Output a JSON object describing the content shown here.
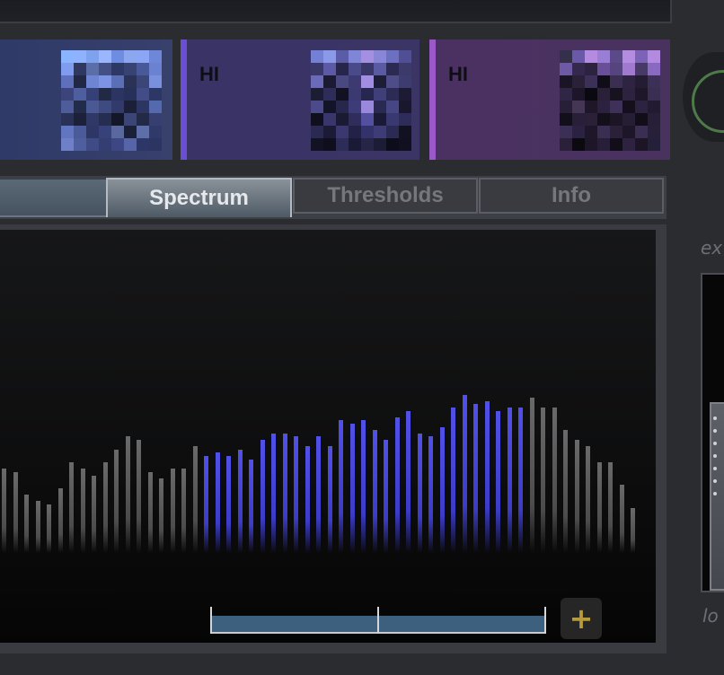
{
  "bands": [
    {
      "label": "",
      "accent": "#2f3a68",
      "grid": [
        "#8ab4ff",
        "#8fb2ff",
        "#7fa2ef",
        "#9bb6ff",
        "#6f8de0",
        "#8ca7f0",
        "#8aa6f4",
        "#6f87d8",
        "#7f9cf0",
        "#2f3860",
        "#5b6ea8",
        "#444f86",
        "#2e3866",
        "#394373",
        "#485898",
        "#6a82cf",
        "#5e70bb",
        "#202846",
        "#6e85d3",
        "#7d94e4",
        "#5b6fb6",
        "#2b3258",
        "#3b4577",
        "#7890de",
        "#3c457b",
        "#4e5e9f",
        "#354079",
        "#212945",
        "#2c3562",
        "#273058",
        "#424d87",
        "#2d3765",
        "#4f5c9b",
        "#232b4b",
        "#4a5894",
        "#3e4a80",
        "#313a6a",
        "#1b2038",
        "#2d3663",
        "#556aae",
        "#2a3158",
        "#1c2139",
        "#2f3866",
        "#252d50",
        "#131727",
        "#3b4677",
        "#222a48",
        "#363f70",
        "#6275c0",
        "#4b5a98",
        "#2d3664",
        "#38427a",
        "#59689f",
        "#1b2039",
        "#5d6ea9",
        "#303a6a",
        "#6e80c7",
        "#4e5e9f",
        "#3f4b85",
        "#343e73",
        "#3c4784",
        "#5765a8",
        "#2d3767",
        "#2c3561"
      ]
    },
    {
      "label": "HI",
      "accent": "#6b4fd2",
      "grid": [
        "#7480d4",
        "#8a9ae8",
        "#5a5ca8",
        "#7f86d8",
        "#a48fe0",
        "#8a86d6",
        "#6d6fc0",
        "#504f96",
        "#3a3868",
        "#5c5aa6",
        "#27254a",
        "#4a4a8a",
        "#383768",
        "#5a5aa2",
        "#2b2a52",
        "#3b3a6b",
        "#6a6ab8",
        "#1b1a33",
        "#4a4880",
        "#3c3a70",
        "#a18ee2",
        "#1e1d38",
        "#4e4d88",
        "#3d3c70",
        "#1d1c35",
        "#2e2c58",
        "#111122",
        "#3a3970",
        "#272650",
        "#413f7a",
        "#2c2b55",
        "#1c1b33",
        "#4c4a8a",
        "#141428",
        "#27264c",
        "#3e3c78",
        "#9a88dc",
        "#2a2952",
        "#464684",
        "#18172e",
        "#0f0f1e",
        "#38366a",
        "#1a1a33",
        "#2f2e5a",
        "#5350a0",
        "#1a1936",
        "#3a3870",
        "#2e2c5a",
        "#2a2952",
        "#1c1b37",
        "#3a386e",
        "#232246",
        "#34326a",
        "#3e3c76",
        "#2b2a55",
        "#111122",
        "#121225",
        "#0e0e1d",
        "#2d2c58",
        "#1b1a36",
        "#262548",
        "#1d1c37",
        "#0c0c1a",
        "#101020"
      ]
    },
    {
      "label": "HI",
      "accent": "#9a58c8",
      "grid": [
        "#34304c",
        "#6a58a8",
        "#b48be0",
        "#9a7ed6",
        "#5a4a8a",
        "#b48ce0",
        "#7d63b8",
        "#b28adf",
        "#6e5aa4",
        "#34284c",
        "#2c2340",
        "#694e98",
        "#56447e",
        "#a17ad0",
        "#473a66",
        "#8a6ac0",
        "#1a1524",
        "#2a2138",
        "#3c2f58",
        "#110d18",
        "#3a2e52",
        "#2e2442",
        "#241c33",
        "#3d3056",
        "#2f2544",
        "#1c1628",
        "#0b0910",
        "#2a2138",
        "#17121f",
        "#2d2340",
        "#1d1729",
        "#3a2e52",
        "#271f37",
        "#453656",
        "#1e1729",
        "#2c2240",
        "#3e3058",
        "#140f1b",
        "#2c2340",
        "#221a30",
        "#130f1a",
        "#281f38",
        "#2a2138",
        "#130f1b",
        "#1b1526",
        "#261e35",
        "#120e19",
        "#271f37",
        "#3c2f56",
        "#2b2241",
        "#1d1729",
        "#3a2e52",
        "#2a2138",
        "#1c1628",
        "#3a2e52",
        "#281f38",
        "#2a2138",
        "#0c0a11",
        "#1c1628",
        "#271f37",
        "#120e19",
        "#2d2340",
        "#1b1526",
        "#24203a"
      ]
    }
  ],
  "tabs": [
    {
      "label": "Spectrum",
      "active": true
    },
    {
      "label": "Thresholds",
      "active": false
    },
    {
      "label": "Info",
      "active": false
    }
  ],
  "spectrum": {
    "colors": {
      "inactive": "#555555",
      "active": "#4444dd"
    },
    "bars": [
      {
        "level": 0.26,
        "active": false
      },
      {
        "level": 0.25,
        "active": false
      },
      {
        "level": 0.18,
        "active": false
      },
      {
        "level": 0.16,
        "active": false
      },
      {
        "level": 0.15,
        "active": false
      },
      {
        "level": 0.2,
        "active": false
      },
      {
        "level": 0.28,
        "active": false
      },
      {
        "level": 0.26,
        "active": false
      },
      {
        "level": 0.24,
        "active": false
      },
      {
        "level": 0.28,
        "active": false
      },
      {
        "level": 0.32,
        "active": false
      },
      {
        "level": 0.36,
        "active": false
      },
      {
        "level": 0.35,
        "active": false
      },
      {
        "level": 0.25,
        "active": false
      },
      {
        "level": 0.23,
        "active": false
      },
      {
        "level": 0.26,
        "active": false
      },
      {
        "level": 0.26,
        "active": false
      },
      {
        "level": 0.33,
        "active": false
      },
      {
        "level": 0.3,
        "active": true
      },
      {
        "level": 0.31,
        "active": true
      },
      {
        "level": 0.3,
        "active": true
      },
      {
        "level": 0.32,
        "active": true
      },
      {
        "level": 0.29,
        "active": true
      },
      {
        "level": 0.35,
        "active": true
      },
      {
        "level": 0.37,
        "active": true
      },
      {
        "level": 0.37,
        "active": true
      },
      {
        "level": 0.36,
        "active": true
      },
      {
        "level": 0.33,
        "active": true
      },
      {
        "level": 0.36,
        "active": true
      },
      {
        "level": 0.33,
        "active": true
      },
      {
        "level": 0.41,
        "active": true
      },
      {
        "level": 0.4,
        "active": true
      },
      {
        "level": 0.41,
        "active": true
      },
      {
        "level": 0.38,
        "active": true
      },
      {
        "level": 0.35,
        "active": true
      },
      {
        "level": 0.42,
        "active": true
      },
      {
        "level": 0.44,
        "active": true
      },
      {
        "level": 0.37,
        "active": true
      },
      {
        "level": 0.36,
        "active": true
      },
      {
        "level": 0.39,
        "active": true
      },
      {
        "level": 0.45,
        "active": true
      },
      {
        "level": 0.49,
        "active": true
      },
      {
        "level": 0.46,
        "active": true
      },
      {
        "level": 0.47,
        "active": true
      },
      {
        "level": 0.44,
        "active": true
      },
      {
        "level": 0.45,
        "active": true
      },
      {
        "level": 0.45,
        "active": true
      },
      {
        "level": 0.48,
        "active": false
      },
      {
        "level": 0.45,
        "active": false
      },
      {
        "level": 0.45,
        "active": false
      },
      {
        "level": 0.38,
        "active": false
      },
      {
        "level": 0.35,
        "active": false
      },
      {
        "level": 0.33,
        "active": false
      },
      {
        "level": 0.28,
        "active": false
      },
      {
        "level": 0.28,
        "active": false
      },
      {
        "level": 0.21,
        "active": false
      },
      {
        "level": 0.14,
        "active": false
      }
    ]
  },
  "range_selector": {
    "start": 0.32,
    "end": 0.83,
    "add_label": "+"
  },
  "side": {
    "label_top": "ex",
    "label_bottom": "lo",
    "meter_level": 0.6
  }
}
